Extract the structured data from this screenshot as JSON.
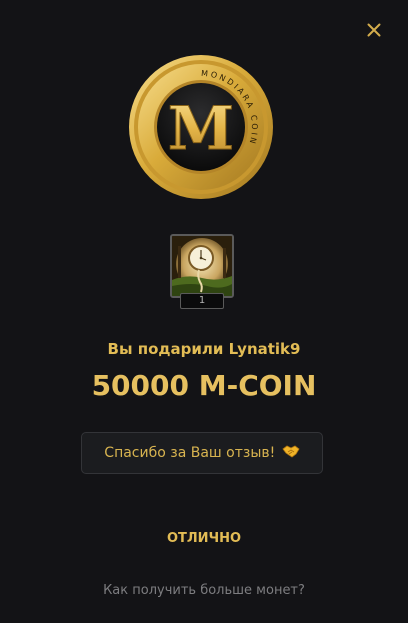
{
  "close": {
    "icon": "close-icon"
  },
  "coin": {
    "letter": "M",
    "ring_text": "MONDIARA COIN",
    "colors": {
      "gold": "#d9ab3a",
      "gold_light": "#f6dc8a",
      "dark": "#0c0c0c"
    }
  },
  "gift": {
    "count": "1"
  },
  "message": {
    "gift_line": "Вы подарили Lynatik9",
    "amount": "50000 M-COIN"
  },
  "thanks_button": {
    "label": "Спасибо за Ваш отзыв!",
    "icon": "handshake-icon"
  },
  "ok_button": {
    "label": "ОТЛИЧНО"
  },
  "more_link": {
    "label": "Как получить больше монет?"
  },
  "colors": {
    "background": "#131316",
    "accent": "#e2bc55",
    "muted": "#7d7d80"
  }
}
